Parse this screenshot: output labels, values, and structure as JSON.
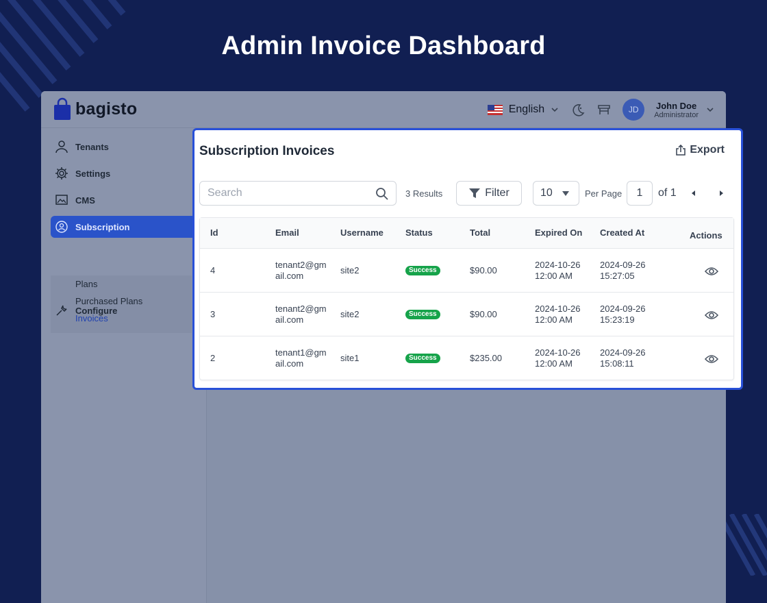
{
  "hero": {
    "title": "Admin Invoice Dashboard"
  },
  "header": {
    "logo_text": "bagisto",
    "language": "English",
    "user": {
      "initials": "JD",
      "name": "John Doe",
      "role": "Administrator"
    }
  },
  "sidebar": {
    "items": [
      {
        "label": "Tenants",
        "icon": "user-icon"
      },
      {
        "label": "Settings",
        "icon": "gear-icon"
      },
      {
        "label": "CMS",
        "icon": "image-icon"
      },
      {
        "label": "Subscription",
        "icon": "users-icon"
      },
      {
        "label": "Configure",
        "icon": "wrench-icon"
      }
    ],
    "submenu": [
      "Plans",
      "Purchased Plans",
      "Invoices"
    ]
  },
  "invoices": {
    "title": "Subscription Invoices",
    "export_label": "Export",
    "search_placeholder": "Search",
    "results_label": "3 Results",
    "filter_label": "Filter",
    "per_page_value": "10",
    "per_page_label": "Per Page",
    "page_current": "1",
    "page_total_label": "of 1",
    "columns": [
      "Id",
      "Email",
      "Username",
      "Status",
      "Total",
      "Expired On",
      "Created At",
      "Actions"
    ],
    "rows": [
      {
        "id": "4",
        "email_1": "tenant2@gm",
        "email_2": "ail.com",
        "username": "site2",
        "status": "Success",
        "total": "$90.00",
        "expired_1": "2024-10-26",
        "expired_2": "12:00 AM",
        "created_1": "2024-09-26",
        "created_2": "15:27:05"
      },
      {
        "id": "3",
        "email_1": "tenant2@gm",
        "email_2": "ail.com",
        "username": "site2",
        "status": "Success",
        "total": "$90.00",
        "expired_1": "2024-10-26",
        "expired_2": "12:00 AM",
        "created_1": "2024-09-26",
        "created_2": "15:23:19"
      },
      {
        "id": "2",
        "email_1": "tenant1@gm",
        "email_2": "ail.com",
        "username": "site1",
        "status": "Success",
        "total": "$235.00",
        "expired_1": "2024-10-26",
        "expired_2": "12:00 AM",
        "created_1": "2024-09-26",
        "created_2": "15:08:11"
      }
    ]
  },
  "colors": {
    "background": "#111f52",
    "accent": "#2850d8",
    "success": "#16a34a",
    "active_nav": "#2a53c9"
  }
}
